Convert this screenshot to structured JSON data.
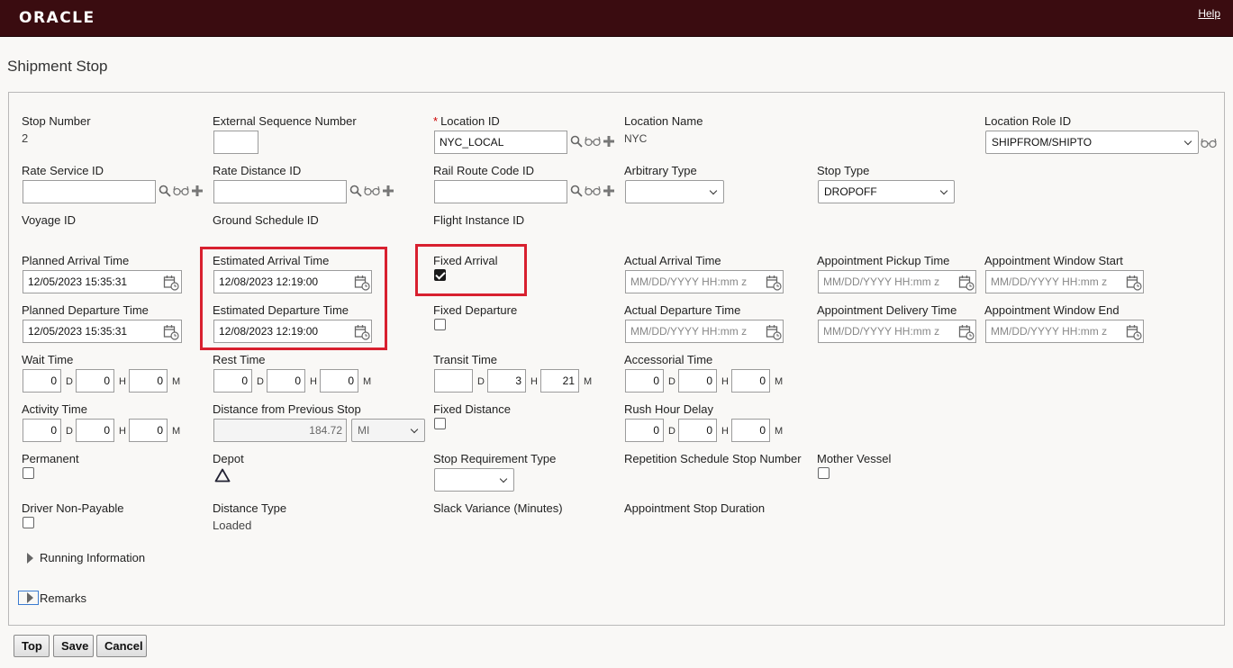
{
  "header": {
    "logo": "ORACLE",
    "help": "Help"
  },
  "page": {
    "title": "Shipment Stop"
  },
  "fields": {
    "stop_number": {
      "label": "Stop Number",
      "value": "2"
    },
    "external_sequence_number": {
      "label": "External Sequence Number",
      "value": ""
    },
    "location_id": {
      "label": "Location ID",
      "value": "NYC_LOCAL",
      "required": "*"
    },
    "location_name": {
      "label": "Location Name",
      "value": "NYC"
    },
    "location_role_id": {
      "label": "Location Role ID",
      "value": "SHIPFROM/SHIPTO"
    },
    "rate_service_id": {
      "label": "Rate Service ID",
      "value": ""
    },
    "rate_distance_id": {
      "label": "Rate Distance ID",
      "value": ""
    },
    "rail_route_code_id": {
      "label": "Rail Route Code ID",
      "value": ""
    },
    "arbitrary_type": {
      "label": "Arbitrary Type",
      "value": ""
    },
    "stop_type": {
      "label": "Stop Type",
      "value": "DROPOFF"
    },
    "voyage_id": {
      "label": "Voyage ID"
    },
    "ground_schedule_id": {
      "label": "Ground Schedule ID"
    },
    "flight_instance_id": {
      "label": "Flight Instance ID"
    },
    "planned_arrival_time": {
      "label": "Planned Arrival Time",
      "value": "12/05/2023 15:35:31"
    },
    "estimated_arrival_time": {
      "label": "Estimated Arrival Time",
      "value": "12/08/2023 12:19:00"
    },
    "fixed_arrival": {
      "label": "Fixed Arrival",
      "checked": true
    },
    "actual_arrival_time": {
      "label": "Actual Arrival Time",
      "placeholder": "MM/DD/YYYY HH:mm z"
    },
    "appointment_pickup_time": {
      "label": "Appointment Pickup Time",
      "placeholder": "MM/DD/YYYY HH:mm z"
    },
    "appointment_window_start": {
      "label": "Appointment Window Start",
      "placeholder": "MM/DD/YYYY HH:mm z"
    },
    "planned_departure_time": {
      "label": "Planned Departure Time",
      "value": "12/05/2023 15:35:31"
    },
    "estimated_departure_time": {
      "label": "Estimated Departure Time",
      "value": "12/08/2023 12:19:00"
    },
    "fixed_departure": {
      "label": "Fixed Departure",
      "checked": false
    },
    "actual_departure_time": {
      "label": "Actual Departure Time",
      "placeholder": "MM/DD/YYYY HH:mm z"
    },
    "appointment_delivery_time": {
      "label": "Appointment Delivery Time",
      "placeholder": "MM/DD/YYYY HH:mm z"
    },
    "appointment_window_end": {
      "label": "Appointment Window End",
      "placeholder": "MM/DD/YYYY HH:mm z"
    },
    "wait_time": {
      "label": "Wait Time",
      "d": "0",
      "h": "0",
      "m": "0"
    },
    "rest_time": {
      "label": "Rest Time",
      "d": "0",
      "h": "0",
      "m": "0"
    },
    "transit_time": {
      "label": "Transit Time",
      "d": "",
      "h": "3",
      "m": "21"
    },
    "accessorial_time": {
      "label": "Accessorial Time",
      "d": "0",
      "h": "0",
      "m": "0"
    },
    "activity_time": {
      "label": "Activity Time",
      "d": "0",
      "h": "0",
      "m": "0"
    },
    "distance_from_previous_stop": {
      "label": "Distance from Previous Stop",
      "value": "184.72",
      "unit": "MI"
    },
    "fixed_distance": {
      "label": "Fixed Distance",
      "checked": false
    },
    "rush_hour_delay": {
      "label": "Rush Hour Delay",
      "d": "0",
      "h": "0",
      "m": "0"
    },
    "permanent": {
      "label": "Permanent",
      "checked": false
    },
    "depot": {
      "label": "Depot"
    },
    "stop_requirement_type": {
      "label": "Stop Requirement Type",
      "value": ""
    },
    "repetition_schedule_stop_number": {
      "label": "Repetition Schedule Stop Number"
    },
    "mother_vessel": {
      "label": "Mother Vessel",
      "checked": false
    },
    "driver_non_payable": {
      "label": "Driver Non-Payable",
      "checked": false
    },
    "distance_type": {
      "label": "Distance Type",
      "value": "Loaded"
    },
    "slack_variance": {
      "label": "Slack Variance (Minutes)"
    },
    "appointment_stop_duration": {
      "label": "Appointment Stop Duration"
    }
  },
  "units": {
    "d": "D",
    "h": "H",
    "m": "M"
  },
  "sections": {
    "running_information": "Running Information",
    "remarks": "Remarks"
  },
  "buttons": {
    "top": "Top",
    "save": "Save",
    "cancel": "Cancel"
  },
  "colors": {
    "header_bg": "#3a0c10",
    "highlight": "#d8202f"
  }
}
